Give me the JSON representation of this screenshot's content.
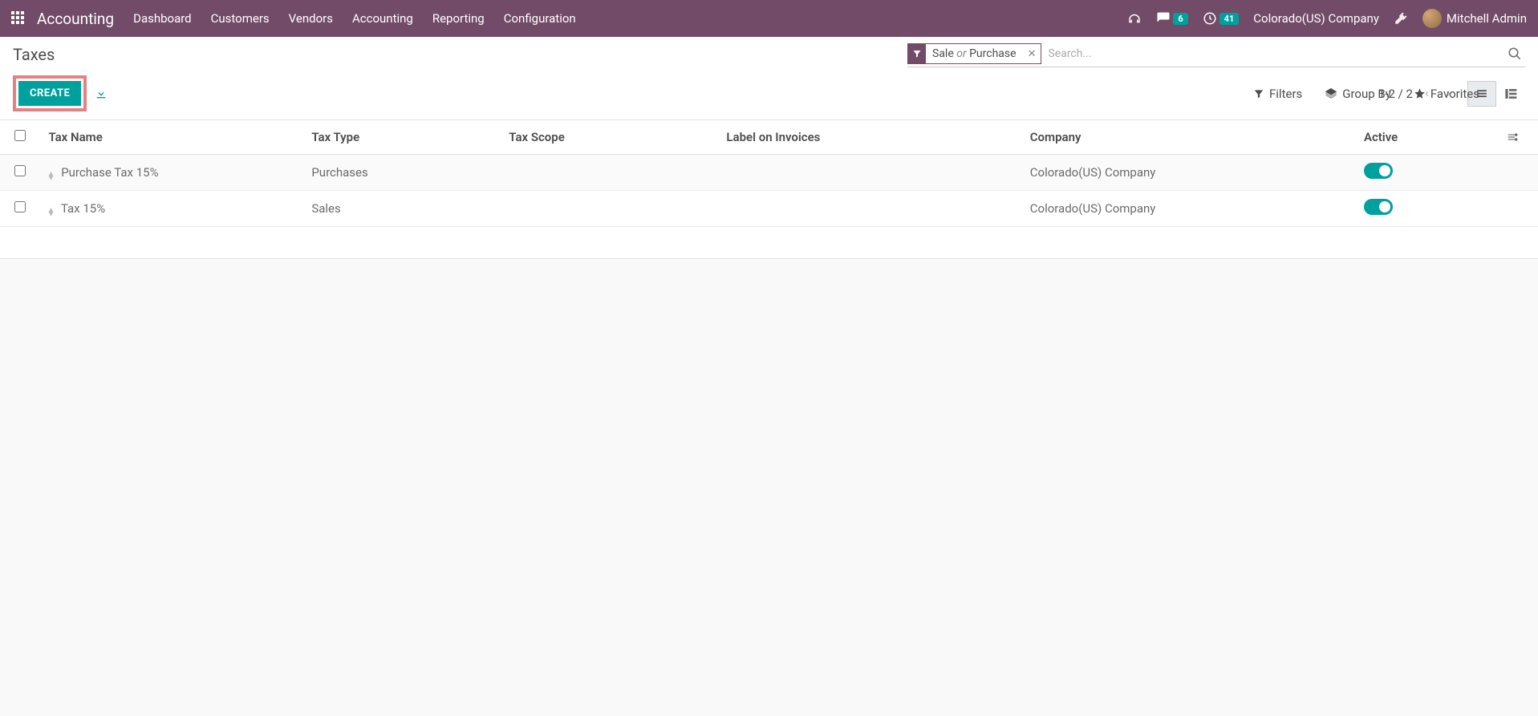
{
  "nav": {
    "app": "Accounting",
    "links": [
      "Dashboard",
      "Customers",
      "Vendors",
      "Accounting",
      "Reporting",
      "Configuration"
    ],
    "chat_badge": "6",
    "clock_badge": "41",
    "company": "Colorado(US) Company",
    "user": "Mitchell Admin"
  },
  "page": {
    "title": "Taxes",
    "create_label": "CREATE",
    "search_placeholder": "Search...",
    "facet_left": "Sale",
    "facet_or": "or",
    "facet_right": "Purchase",
    "filters_label": "Filters",
    "groupby_label": "Group By",
    "favorites_label": "Favorites",
    "pager_text": "1-2 / 2"
  },
  "table": {
    "headers": {
      "tax_name": "Tax Name",
      "tax_type": "Tax Type",
      "tax_scope": "Tax Scope",
      "label_invoices": "Label on Invoices",
      "company": "Company",
      "active": "Active"
    },
    "rows": [
      {
        "name": "Purchase Tax 15%",
        "type": "Purchases",
        "scope": "",
        "label": "",
        "company": "Colorado(US) Company",
        "active": true
      },
      {
        "name": "Tax 15%",
        "type": "Sales",
        "scope": "",
        "label": "",
        "company": "Colorado(US) Company",
        "active": true
      }
    ]
  }
}
